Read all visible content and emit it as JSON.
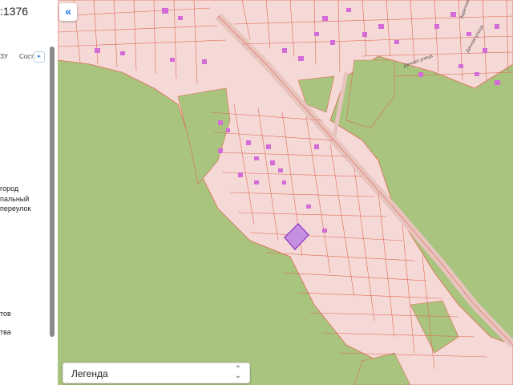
{
  "panel": {
    "cadastral_number": ":1376",
    "tabs": {
      "zu": "ЗУ",
      "sostav": "Сост"
    },
    "address_lines": [
      "город",
      "пальный",
      "переулок"
    ],
    "footer_lines": [
      "тов",
      "тва"
    ]
  },
  "map": {
    "collapse_label": "«",
    "streets": [
      "Дачная улица",
      "Дачная улица",
      "Заречная улица"
    ],
    "colors": {
      "parcel_fill": "#f5d9d6",
      "parcel_line": "#e06b55",
      "forest": "#a8c47e",
      "building": "#d36bd9",
      "selected_parcel": "#c690e0",
      "selected_outline": "#8a2fc4"
    }
  },
  "legend": {
    "label": "Легенда",
    "chevron": "⌃⌄"
  }
}
